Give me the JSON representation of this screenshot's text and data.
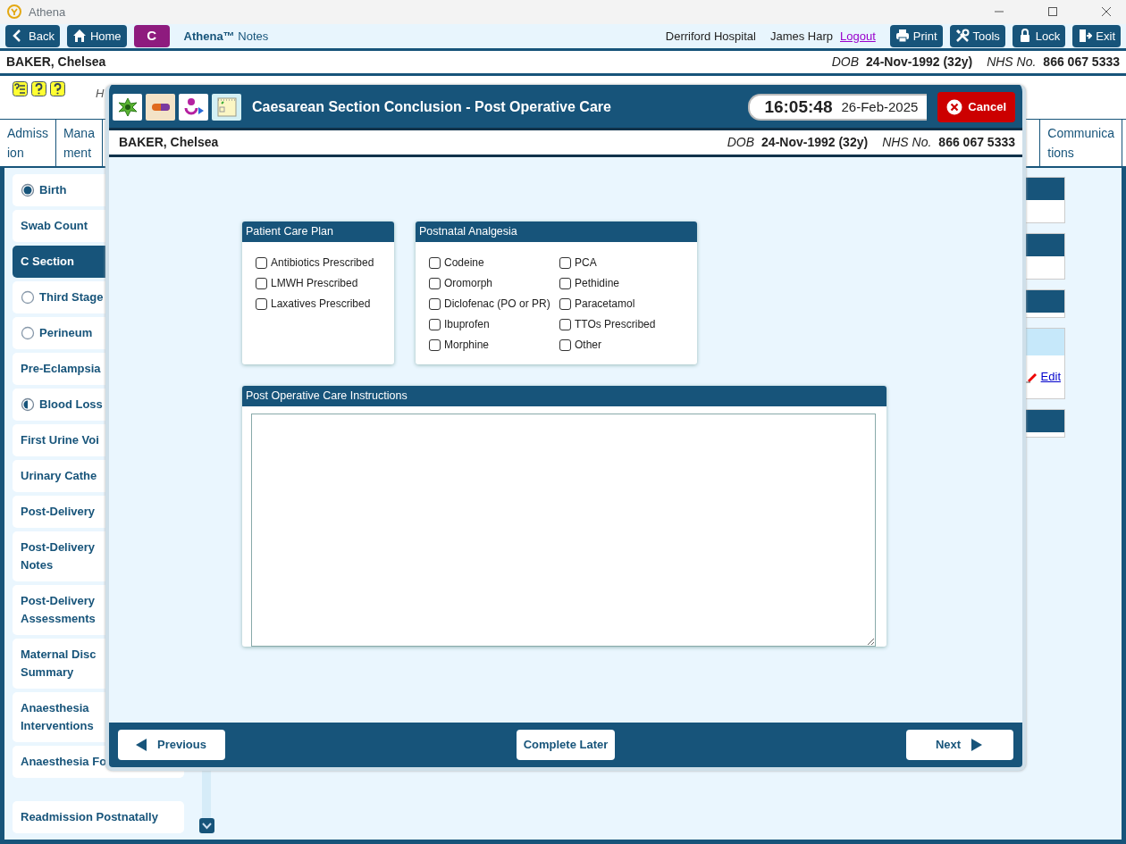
{
  "window": {
    "title": "Athena"
  },
  "toolbar": {
    "left_buttons": [
      {
        "kind": "back",
        "label": "Back"
      },
      {
        "kind": "home",
        "label": "Home"
      }
    ],
    "badge": "C",
    "app_name": "Athena™",
    "app_suffix": "Notes",
    "hospital": "Derriford Hospital",
    "user": "James Harp",
    "logout": "Logout",
    "right_buttons": [
      {
        "kind": "print",
        "label": "Print"
      },
      {
        "kind": "tools",
        "label": "Tools"
      },
      {
        "kind": "lock",
        "label": "Lock"
      },
      {
        "kind": "exit",
        "label": "Exit"
      }
    ]
  },
  "patient": {
    "name": "BAKER, Chelsea",
    "dob_label": "DOB",
    "dob": "24-Nov-1992 (32y)",
    "nhs_label": "NHS No.",
    "nhs": "866 067 5333"
  },
  "info_row": {
    "text": "H"
  },
  "tabs": [
    {
      "lines": [
        "Admiss",
        "ion"
      ]
    },
    {
      "lines": [
        "Mana",
        "ment"
      ]
    },
    {
      "lines": [
        "Communica",
        "tions"
      ]
    }
  ],
  "sidebar": [
    {
      "label": "Birth",
      "kind": "complete",
      "selected": false
    },
    {
      "label": "Swab Count",
      "kind": "plain",
      "selected": false
    },
    {
      "label": "C Section",
      "kind": "plain",
      "selected": true
    },
    {
      "label": "Third Stage",
      "kind": "empty",
      "selected": false
    },
    {
      "label": "Perineum",
      "kind": "empty",
      "selected": false
    },
    {
      "label": "Pre-Eclampsia",
      "kind": "plain",
      "selected": false
    },
    {
      "label": "Blood Loss",
      "kind": "partial",
      "selected": false
    },
    {
      "label": "First Urine Voi",
      "kind": "plain",
      "selected": false
    },
    {
      "label": "Urinary Cathe",
      "kind": "plain",
      "selected": false
    },
    {
      "label": "Post-Delivery",
      "kind": "plain",
      "selected": false
    },
    {
      "label": "Post-Delivery\nNotes",
      "kind": "plain",
      "selected": false
    },
    {
      "label": "Post-Delivery\nAssessments",
      "kind": "plain",
      "selected": false
    },
    {
      "label": "Maternal Disc\nSummary",
      "kind": "plain",
      "selected": false
    },
    {
      "label": "Anaesthesia\nInterventions",
      "kind": "plain",
      "selected": false
    },
    {
      "label": "Anaesthesia Fo",
      "kind": "plain",
      "selected": false
    },
    {
      "label": "Readmission Postnatally",
      "kind": "plain",
      "selected": false
    }
  ],
  "right_panels": [
    {
      "kind": "dark"
    },
    {
      "kind": "dark"
    },
    {
      "kind": "short"
    },
    {
      "kind": "edit",
      "link": "Edit"
    },
    {
      "kind": "short"
    }
  ],
  "dialog": {
    "title": "Caesarean Section Conclusion - Post Operative Care",
    "time": "16:05:48",
    "date": "26-Feb-2025",
    "cancel": "Cancel",
    "patient": {
      "name": "BAKER, Chelsea",
      "dob_label": "DOB",
      "dob": "24-Nov-1992 (32y)",
      "nhs_label": "NHS No.",
      "nhs": "866 067 5333"
    },
    "care_plan": {
      "title": "Patient Care Plan",
      "items": [
        {
          "label": "Antibiotics Prescribed",
          "checked": false
        },
        {
          "label": "LMWH Prescribed",
          "checked": false
        },
        {
          "label": "Laxatives Prescribed",
          "checked": false
        }
      ]
    },
    "analgesia": {
      "title": "Postnatal Analgesia",
      "items": [
        {
          "label": "Codeine",
          "checked": false
        },
        {
          "label": "Oromorph",
          "checked": false
        },
        {
          "label": "Diclofenac (PO or PR)",
          "checked": false
        },
        {
          "label": "Ibuprofen",
          "checked": false
        },
        {
          "label": "Morphine",
          "checked": false
        },
        {
          "label": "PCA",
          "checked": false
        },
        {
          "label": "Pethidine",
          "checked": false
        },
        {
          "label": "Paracetamol",
          "checked": false
        },
        {
          "label": "TTOs Prescribed",
          "checked": false
        },
        {
          "label": "Other",
          "checked": false
        }
      ]
    },
    "instructions": {
      "title": "Post Operative Care Instructions"
    },
    "footer": {
      "previous": "Previous",
      "complete_later": "Complete Later",
      "next": "Next"
    }
  }
}
